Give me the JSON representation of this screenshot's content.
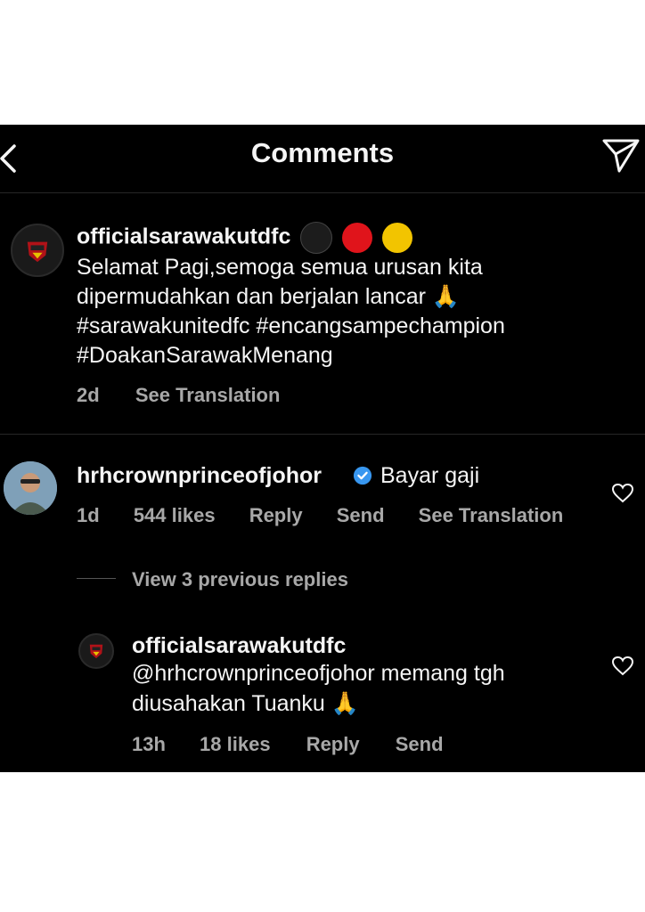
{
  "header": {
    "title": "Comments"
  },
  "caption": {
    "username": "officialsarawakutdfc",
    "line1": "Selamat Pagi,semoga semua urusan kita",
    "line2": "dipermudahkan dan berjalan lancar 🙏",
    "line3": "#sarawakunitedfc #encangsampechampion",
    "line4": "#DoakanSarawakMenang",
    "time": "2d",
    "translate": "See Translation",
    "colors": [
      "#1c1c1c",
      "#e0141b",
      "#f2c400"
    ]
  },
  "comment": {
    "username": "hrhcrownprinceofjohor",
    "text": "Bayar gaji",
    "time": "1d",
    "likes": "544 likes",
    "reply": "Reply",
    "send": "Send",
    "translate": "See Translation",
    "verified_color": "#3897f0"
  },
  "view_replies": "View 3 previous replies",
  "reply": {
    "username": "officialsarawakutdfc",
    "line1": "@hrhcrownprinceofjohor memang tgh",
    "line2": "diusahakan Tuanku 🙏",
    "time": "13h",
    "likes": "18 likes",
    "reply": "Reply",
    "send": "Send"
  }
}
